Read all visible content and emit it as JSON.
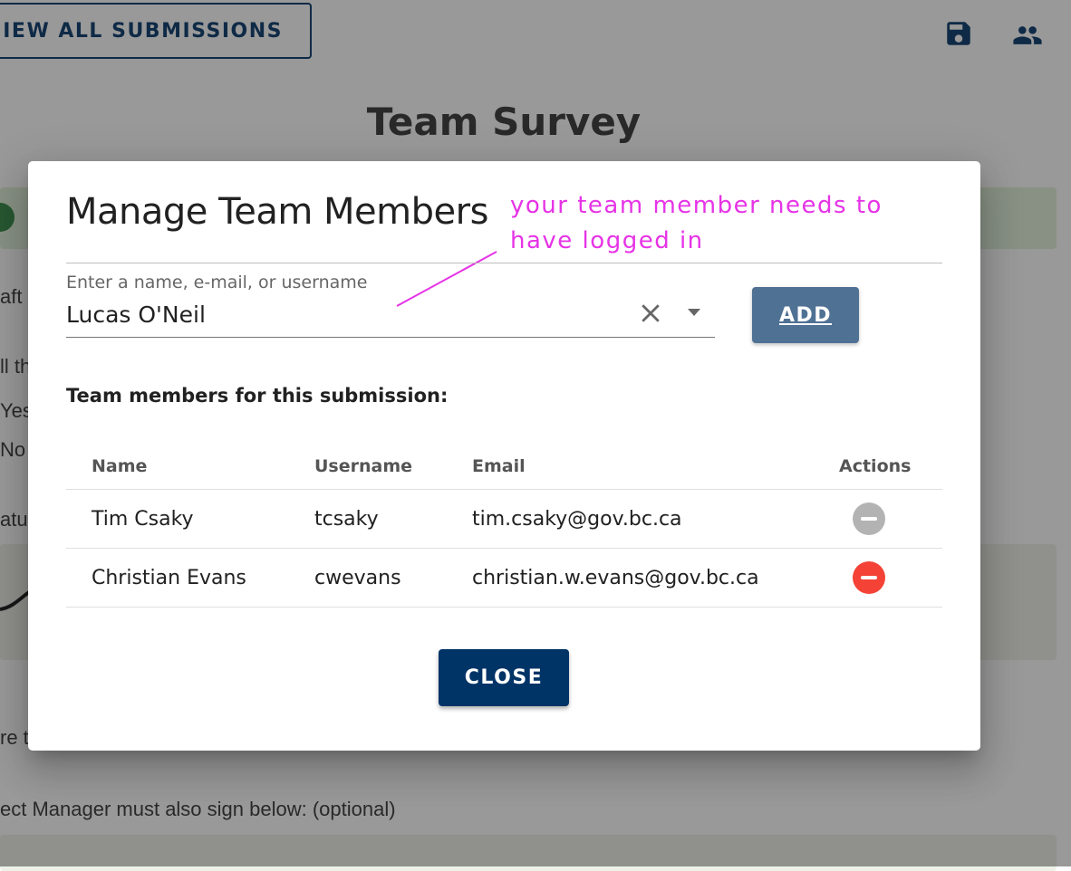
{
  "header": {
    "view_all_label": "IEW ALL SUBMISSIONS",
    "save_icon": "save-icon",
    "team_icon": "people-icon"
  },
  "page": {
    "title": "Team Survey",
    "fragments": {
      "draft": "aft",
      "all_the": "ll th",
      "yes": "Yes",
      "no": "No",
      "signature": "atu",
      "sure": "re t",
      "manager_sign": "ect Manager must also sign below: (optional)"
    }
  },
  "dialog": {
    "title": "Manage Team Members",
    "annotation": "your team member needs to\nhave logged in",
    "search": {
      "label": "Enter a name, e-mail, or username",
      "value": "Lucas O'Neil"
    },
    "add_label": "ADD",
    "section_heading": "Team members for this submission:",
    "table": {
      "headers": {
        "name": "Name",
        "username": "Username",
        "email": "Email",
        "actions": "Actions"
      },
      "rows": [
        {
          "name": "Tim Csaky",
          "username": "tcsaky",
          "email": "tim.csaky@gov.bc.ca",
          "action": "remove-disabled"
        },
        {
          "name": "Christian Evans",
          "username": "cwevans",
          "email": "christian.w.evans@gov.bc.ca",
          "action": "remove-active"
        }
      ]
    },
    "close_label": "CLOSE"
  },
  "colors": {
    "primary": "#003366",
    "add_button": "#4f7194",
    "remove_active": "#f44336",
    "remove_disabled": "#b3b3b3",
    "annotation": "#e633e6"
  }
}
